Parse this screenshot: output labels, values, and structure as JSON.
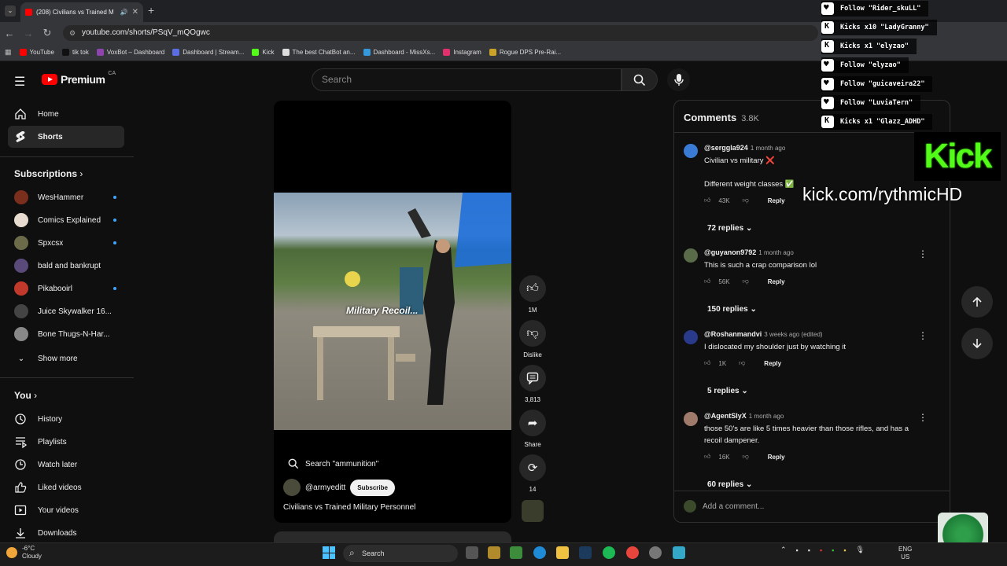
{
  "browser": {
    "tab_title": "(208) Civilians vs Trained M",
    "url": "youtube.com/shorts/PSqV_mQOgwc",
    "bookmarks": [
      {
        "label": "YouTube",
        "color": "#ff0000"
      },
      {
        "label": "tik tok",
        "color": "#111111"
      },
      {
        "label": "VoxBot – Dashboard",
        "color": "#8e44ad"
      },
      {
        "label": "Dashboard | Stream...",
        "color": "#5b6ee1"
      },
      {
        "label": "Kick",
        "color": "#53fc18"
      },
      {
        "label": "The best ChatBot an...",
        "color": "#dddddd"
      },
      {
        "label": "Dashboard - MissXs...",
        "color": "#3498db"
      },
      {
        "label": "Instagram",
        "color": "#e1306c"
      },
      {
        "label": "Rogue DPS Pre-Rai...",
        "color": "#c9a227"
      }
    ]
  },
  "header": {
    "logo_text": "Premium",
    "country": "CA",
    "search_placeholder": "Search"
  },
  "sidebar": {
    "main": [
      {
        "label": "Home",
        "icon": "home-icon"
      },
      {
        "label": "Shorts",
        "icon": "shorts-icon"
      }
    ],
    "subscriptions_title": "Subscriptions",
    "subscriptions": [
      {
        "label": "WesHammer",
        "color": "#7a2e1c",
        "live": true
      },
      {
        "label": "Comics Explained",
        "color": "#e8dcd0",
        "live": true
      },
      {
        "label": "Spxcsx",
        "color": "#6b6b4a",
        "live": true
      },
      {
        "label": "bald and bankrupt",
        "color": "#5a4a7a",
        "live": false
      },
      {
        "label": "Pikabooirl",
        "color": "#c0392b",
        "live": true
      },
      {
        "label": "Juice Skywalker 16...",
        "color": "#444444",
        "live": false
      },
      {
        "label": "Bone Thugs-N-Har...",
        "color": "#888888",
        "live": false
      }
    ],
    "show_more": "Show more",
    "you_title": "You",
    "you": [
      {
        "label": "History",
        "icon": "history-icon"
      },
      {
        "label": "Playlists",
        "icon": "playlists-icon"
      },
      {
        "label": "Watch later",
        "icon": "watch-later-icon"
      },
      {
        "label": "Liked videos",
        "icon": "like-icon"
      },
      {
        "label": "Your videos",
        "icon": "your-videos-icon"
      },
      {
        "label": "Downloads",
        "icon": "download-icon"
      }
    ]
  },
  "video": {
    "overlay_caption": "Military Recoil...",
    "search_suggestion": "Search \"ammunition\"",
    "channel": "@armyeditt",
    "subscribe": "Subscribe",
    "title": "Civilians vs Trained Military Personnel"
  },
  "actions": {
    "likes": "1M",
    "dislike": "Dislike",
    "comments": "3,813",
    "share": "Share",
    "remix": "14"
  },
  "comments": {
    "title": "Comments",
    "count": "3.8K",
    "add_placeholder": "Add a comment...",
    "items": [
      {
        "user": "@serggla924",
        "time": "1 month ago",
        "text_lines": [
          "Civilian vs military ❌",
          "",
          "Different weight classes ✅"
        ],
        "likes": "43K",
        "replies": "72 replies",
        "color": "#3a7bd5"
      },
      {
        "user": "@guyanon9792",
        "time": "1 month ago",
        "text_lines": [
          "This is such a crap comparison lol"
        ],
        "likes": "56K",
        "replies": "150 replies",
        "color": "#5a6b4a"
      },
      {
        "user": "@Roshanmandvi",
        "time": "3 weeks ago (edited)",
        "text_lines": [
          "I dislocated my shoulder just by watching it"
        ],
        "likes": "1K",
        "replies": "5 replies",
        "color": "#2a3a8a"
      },
      {
        "user": "@AgentSlyX",
        "time": "1 month ago",
        "text_lines": [
          "those 50's are like 5 times heavier than those rifles, and has a",
          "recoil dampener."
        ],
        "likes": "16K",
        "replies": "60 replies",
        "color": "#a07a6a"
      }
    ],
    "reply_label": "Reply"
  },
  "stream_overlay": {
    "events": [
      {
        "type": "follow",
        "text": "Follow \"Rider_skuLL\""
      },
      {
        "type": "kick",
        "text": "Kicks x10 \"LadyGranny\""
      },
      {
        "type": "kick",
        "text": "Kicks x1 \"elyzao\""
      },
      {
        "type": "follow",
        "text": "Follow \"elyzao\""
      },
      {
        "type": "follow",
        "text": "Follow \"guicaveira22\""
      },
      {
        "type": "follow",
        "text": "Follow \"LuviaTern\""
      },
      {
        "type": "kick",
        "text": "Kicks x1 \"Glazz_ADHD\""
      }
    ],
    "logo": "Kick",
    "url": "kick.com/rythmicHD"
  },
  "taskbar": {
    "weather_temp": "-6°C",
    "weather_desc": "Cloudy",
    "search": "Search",
    "lang": "ENG",
    "region": "US"
  }
}
